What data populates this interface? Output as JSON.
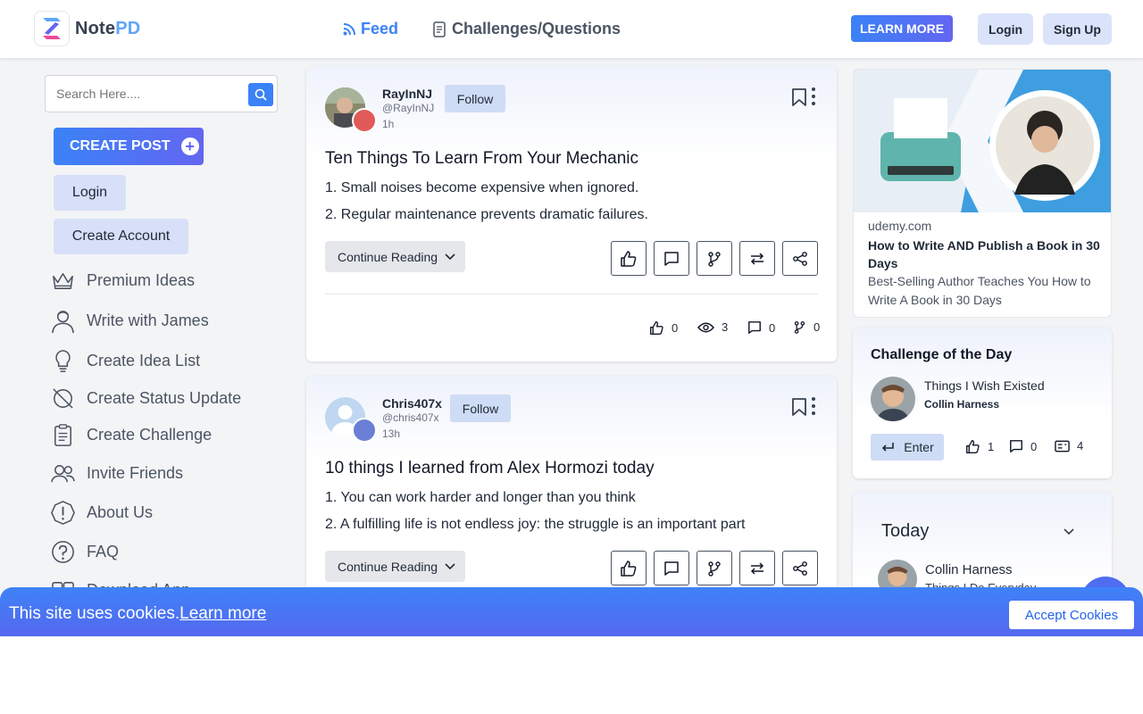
{
  "header": {
    "logo_text_a": "Note",
    "logo_text_b": "PD",
    "nav_feed": "Feed",
    "nav_challenges": "Challenges/Questions",
    "learn_more": "LEARN MORE",
    "login": "Login",
    "signup": "Sign Up"
  },
  "sidebar": {
    "search_placeholder": "Search Here....",
    "create_post": "CREATE POST",
    "login": "Login",
    "create_account": "Create Account",
    "items": [
      {
        "label": "Premium Ideas",
        "icon": "crown-icon"
      },
      {
        "label": "Write with James",
        "icon": "person-icon"
      },
      {
        "label": "Create Idea List",
        "icon": "lightbulb-icon"
      },
      {
        "label": "Create Status Update",
        "icon": "status-icon"
      },
      {
        "label": "Create Challenge",
        "icon": "clipboard-icon"
      },
      {
        "label": "Invite Friends",
        "icon": "users-icon"
      },
      {
        "label": "About Us",
        "icon": "info-icon"
      },
      {
        "label": "FAQ",
        "icon": "question-icon"
      },
      {
        "label": "Download App",
        "icon": "download-icon"
      }
    ]
  },
  "posts": [
    {
      "name": "RayInNJ",
      "handle": "@RayInNJ",
      "time": "1h",
      "follow": "Follow",
      "title": "Ten Things To Learn From Your Mechanic",
      "line1": "1. Small noises become expensive when ignored.",
      "line2": "2. Regular maintenance prevents dramatic failures.",
      "continue": "Continue Reading",
      "likes": "0",
      "views": "3",
      "comments": "0",
      "branches": "0"
    },
    {
      "name": "Chris407x",
      "handle": "@chris407x",
      "time": "13h",
      "follow": "Follow",
      "title": "10 things I learned from Alex Hormozi today",
      "line1": "1. You can work harder and longer than you think",
      "line2": "2. A fulfilling life is not endless joy: the struggle is an important part",
      "continue": "Continue Reading"
    }
  ],
  "ad": {
    "domain": "udemy.com",
    "title": "How to Write AND Publish a Book in 30 Days",
    "description": "Best-Selling Author Teaches You How to Write A Book in 30 Days"
  },
  "challenge": {
    "heading": "Challenge of the Day",
    "title": "Things I Wish Existed",
    "author": "Collin Harness",
    "enter": "Enter",
    "likes": "1",
    "comments": "0",
    "entries": "4"
  },
  "today": {
    "label": "Today",
    "name": "Collin Harness",
    "sub": "Things I Do Everyday"
  },
  "cookie": {
    "text": "This site uses cookies.",
    "link": "Learn more",
    "accept": "Accept Cookies"
  },
  "colors": {
    "accent": "#3b82f6",
    "accent2": "#6366f1",
    "button_light": "#dbe3fb"
  }
}
